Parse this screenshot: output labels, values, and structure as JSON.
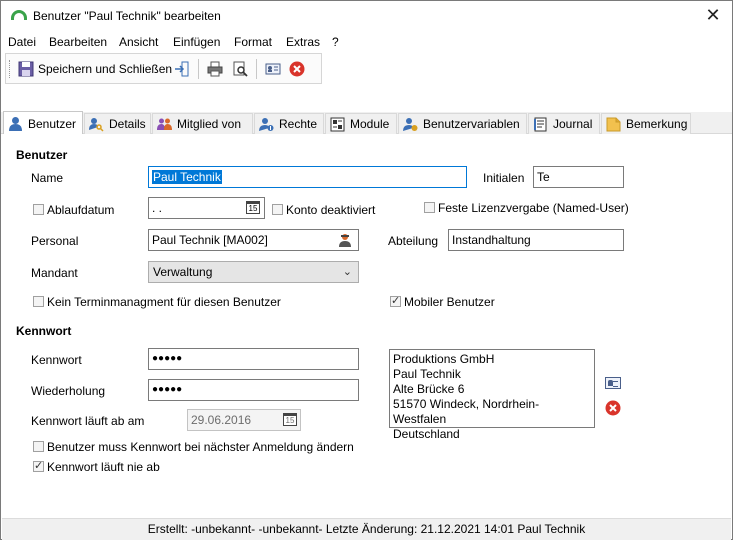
{
  "window": {
    "title": "Benutzer \"Paul Technik\" bearbeiten",
    "close_glyph": "✕"
  },
  "menu": [
    "Datei",
    "Bearbeiten",
    "Ansicht",
    "Einfügen",
    "Format",
    "Extras",
    "?"
  ],
  "toolbar": {
    "save_close_label": "Speichern und Schließen"
  },
  "tabs": [
    {
      "label": "Benutzer",
      "icon": "user-icon",
      "active": true
    },
    {
      "label": "Details",
      "icon": "user-key-icon"
    },
    {
      "label": "Mitglied von",
      "icon": "group-icon"
    },
    {
      "label": "Rechte",
      "icon": "rights-icon"
    },
    {
      "label": "Module",
      "icon": "module-icon"
    },
    {
      "label": "Benutzervariablen",
      "icon": "variables-icon"
    },
    {
      "label": "Journal",
      "icon": "journal-icon"
    },
    {
      "label": "Bemerkung",
      "icon": "note-icon"
    }
  ],
  "benutzer": {
    "section_title": "Benutzer",
    "name_label": "Name",
    "name_value": "Paul Technik",
    "initialen_label": "Initialen",
    "initialen_value": "Te",
    "ablaufdatum_label": "Ablaufdatum",
    "ablaufdatum_value": " .  .",
    "konto_deaktiviert_label": "Konto deaktiviert",
    "feste_lizenz_label": "Feste Lizenzvergabe (Named-User)",
    "personal_label": "Personal",
    "personal_value": "Paul Technik [MA002]",
    "abteilung_label": "Abteilung",
    "abteilung_value": "Instandhaltung",
    "mandant_label": "Mandant",
    "mandant_value": "Verwaltung",
    "kein_termin_label": "Kein Terminmanagment für diesen Benutzer",
    "mobiler_benutzer_label": "Mobiler Benutzer",
    "mobiler_benutzer_checked": true
  },
  "kennwort": {
    "section_title": "Kennwort",
    "kennwort_label": "Kennwort",
    "kennwort_value": "●●●●●",
    "wiederholung_label": "Wiederholung",
    "wiederholung_value": "●●●●●",
    "ablauf_label": "Kennwort läuft ab am",
    "ablauf_value": "29.06.2016",
    "muss_aendern_label": "Benutzer muss Kennwort bei nächster Anmeldung ändern",
    "nie_ab_label": "Kennwort läuft nie ab",
    "nie_ab_checked": true
  },
  "address": [
    "Produktions GmbH",
    "Paul Technik",
    "Alte Brücke 6",
    "51570 Windeck, Nordrhein-Westfalen",
    "Deutschland"
  ],
  "status": "Erstellt: -unbekannt- -unbekannt-  Letzte Änderung: 21.12.2021 14:01 Paul Technik",
  "cal_glyph": "15",
  "combo_arrow": "⌄",
  "colors": {
    "accent": "#0078d7",
    "close_red": "#d9342b",
    "logo_green": "#3aa34a"
  }
}
